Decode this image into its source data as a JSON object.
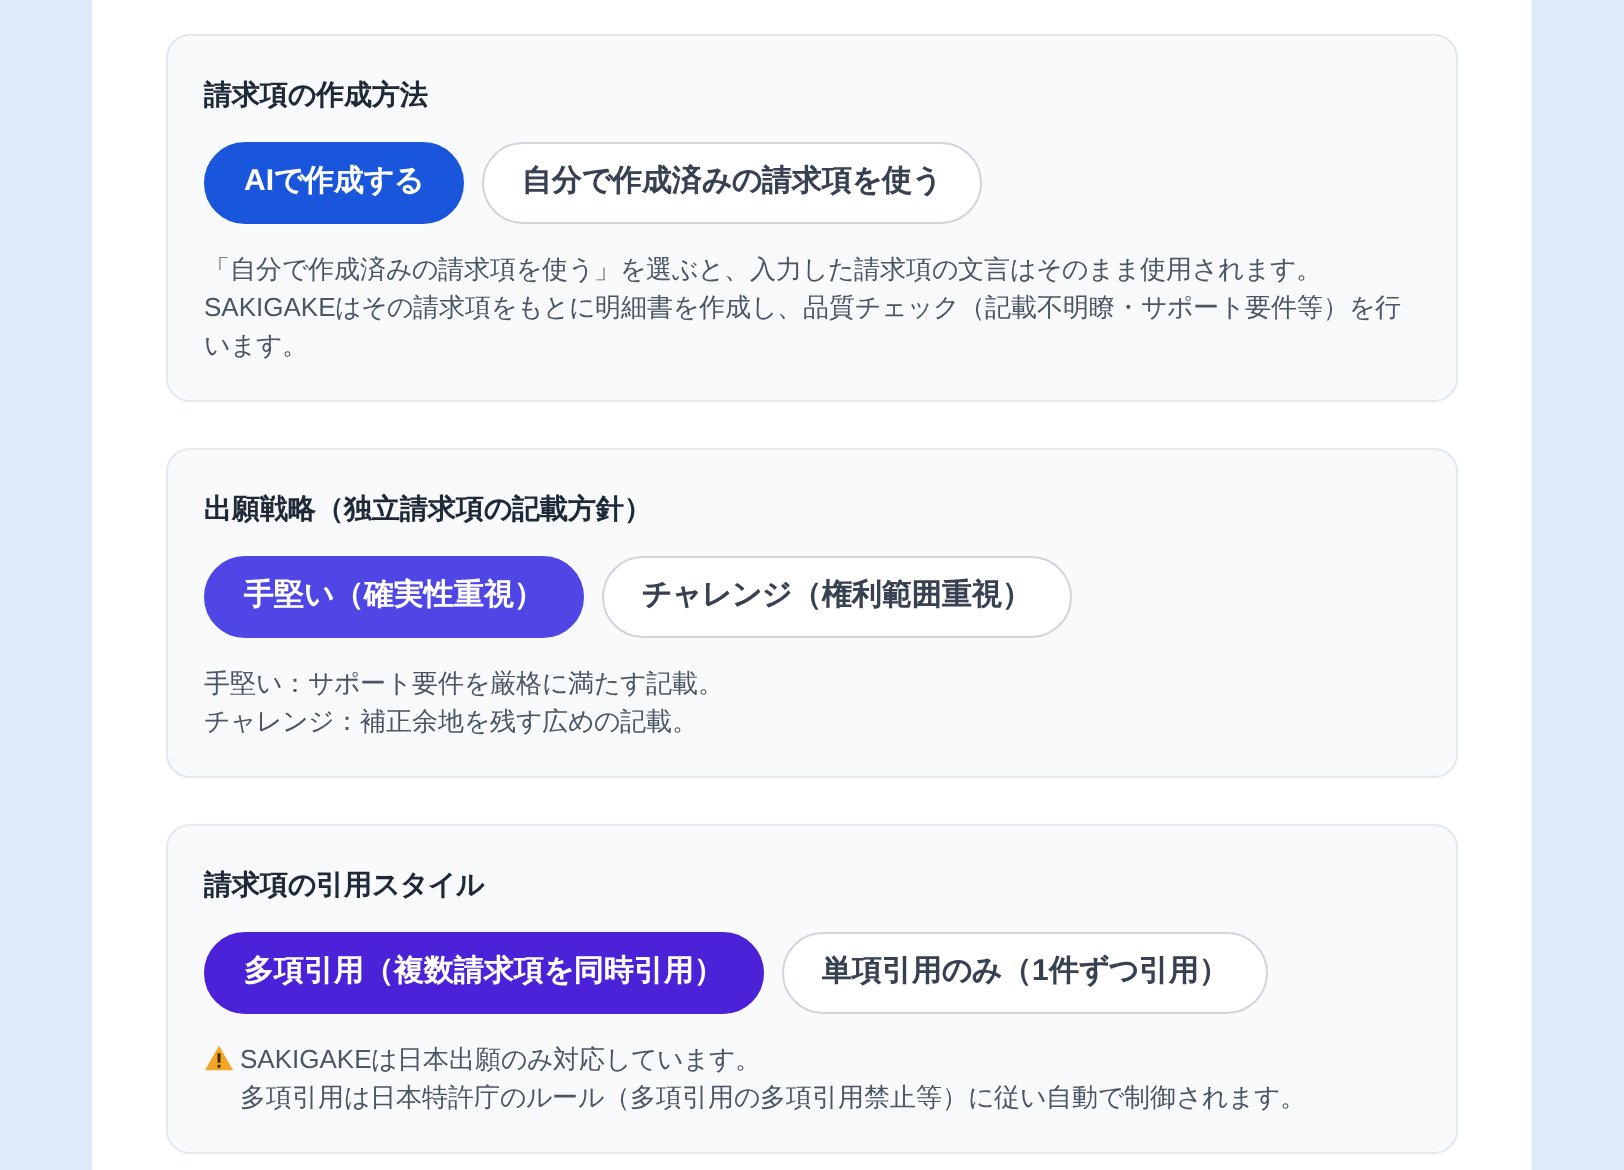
{
  "sections": [
    {
      "title": "請求項の作成方法",
      "color": "#1a56db",
      "options": [
        {
          "label": "AIで作成する",
          "selected": true
        },
        {
          "label": "自分で作成済みの請求項を使う",
          "selected": false
        }
      ],
      "note": {
        "kind": "plain",
        "lines": [
          "「自分で作成済みの請求項を使う」を選ぶと、入力した請求項の文言はそのまま使用されます。",
          "SAKIGAKEはその請求項をもとに明細書を作成し、品質チェック（記載不明瞭・サポート要件等）を行います。"
        ]
      }
    },
    {
      "title": "出願戦略（独立請求項の記載方針）",
      "color": "#4f46e5",
      "options": [
        {
          "label": "手堅い（確実性重視）",
          "selected": true
        },
        {
          "label": "チャレンジ（権利範囲重視）",
          "selected": false
        }
      ],
      "note": {
        "kind": "plain",
        "lines": [
          "手堅い：サポート要件を厳格に満たす記載。",
          "チャレンジ：補正余地を残す広めの記載。"
        ]
      }
    },
    {
      "title": "請求項の引用スタイル",
      "color": "#4c22d8",
      "options": [
        {
          "label": "多項引用（複数請求項を同時引用）",
          "selected": true
        },
        {
          "label": "単項引用のみ（1件ずつ引用）",
          "selected": false
        }
      ],
      "note": {
        "kind": "warning",
        "lines": [
          "SAKIGAKEは日本出願のみ対応しています。",
          "多項引用は日本特許庁のルール（多項引用の多項引用禁止等）に従い自動で制御されます。"
        ]
      }
    }
  ]
}
